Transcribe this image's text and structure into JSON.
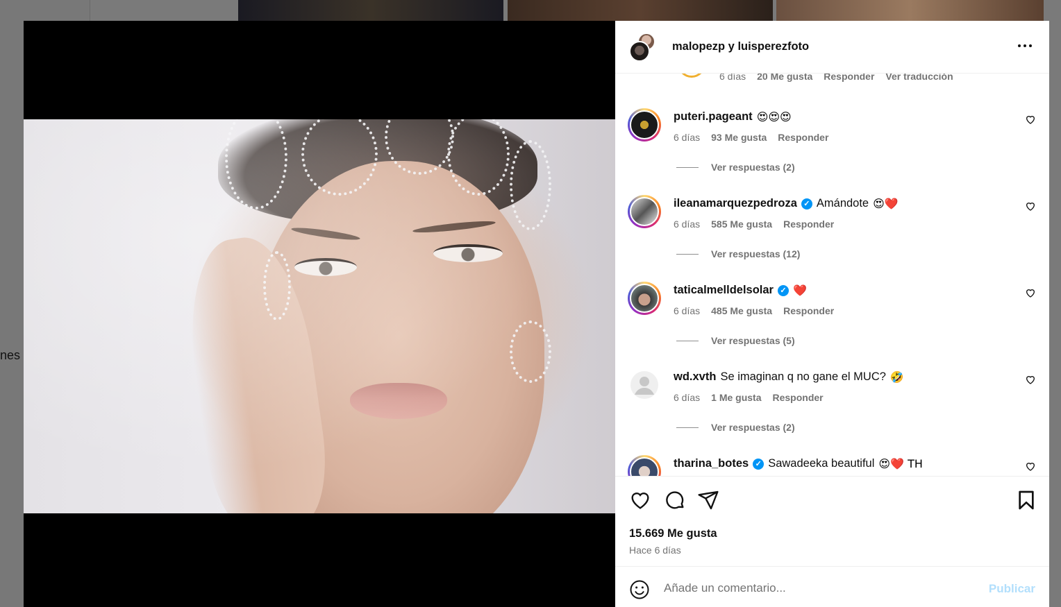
{
  "background": {
    "partial_text": "nes"
  },
  "post": {
    "header_title": "malopezp y luisperezfoto",
    "more_icon": "ellipsis-icon",
    "likes_label": "15.669 Me gusta",
    "time_ago": "Hace 6 días"
  },
  "peek_comment": {
    "time": "6 días",
    "likes": "20 Me gusta",
    "reply": "Responder",
    "translate": "Ver traducción"
  },
  "comments": [
    {
      "username": "puteri.pageant",
      "verified": false,
      "text": "",
      "emojis": "😍😍😍",
      "time": "6 días",
      "likes": "93 Me gusta",
      "reply": "Responder",
      "replies": "Ver respuestas (2)"
    },
    {
      "username": "ileanamarquezpedroza",
      "verified": true,
      "text": "Amándote",
      "emojis": "😍❤️",
      "time": "6 días",
      "likes": "585 Me gusta",
      "reply": "Responder",
      "replies": "Ver respuestas (12)"
    },
    {
      "username": "taticalmelldelsolar",
      "verified": true,
      "text": "",
      "emojis": "❤️",
      "time": "6 días",
      "likes": "485 Me gusta",
      "reply": "Responder",
      "replies": "Ver respuestas (5)"
    },
    {
      "username": "wd.xvth",
      "verified": false,
      "text": "Se imaginan q no gane el MUC?",
      "emojis": "🤣",
      "time": "6 días",
      "likes": "1 Me gusta",
      "reply": "Responder",
      "replies": "Ver respuestas (2)"
    },
    {
      "username": "tharina_botes",
      "verified": true,
      "text": "Sawadeeka beautiful",
      "emojis": "😍❤️ TH",
      "time": "",
      "likes": "",
      "reply": "",
      "replies": ""
    }
  ],
  "comment_box": {
    "placeholder": "Añade un comentario...",
    "publish_label": "Publicar"
  },
  "colors": {
    "accent_blue": "#0095f6",
    "publish_disabled": "#b2dffc",
    "muted_text": "#737373"
  }
}
